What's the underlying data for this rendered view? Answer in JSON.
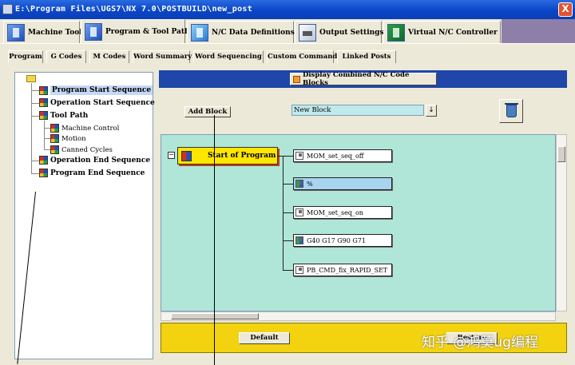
{
  "window": {
    "title": "E:\\Program Files\\UGS7\\NX 7.0\\POSTBUILD\\new_post",
    "close_glyph": "X"
  },
  "main_tabs": [
    {
      "label": "Machine Tool",
      "icon": "machine-tool-icon"
    },
    {
      "label": "Program & Tool Path",
      "icon": "program-toolpath-icon"
    },
    {
      "label": "N/C Data Definitions",
      "icon": "nc-data-icon"
    },
    {
      "label": "Output Settings",
      "icon": "printer-icon"
    },
    {
      "label": "Virtual N/C Controller",
      "icon": "virtual-controller-icon"
    }
  ],
  "sub_tabs": [
    "Program",
    "G Codes",
    "M Codes",
    "Word Summary",
    "Word Sequencing",
    "Custom Command",
    "Linked Posts"
  ],
  "tree": {
    "items": [
      {
        "label": "Program Start Sequence",
        "selected": true
      },
      {
        "label": "Operation Start Sequence"
      },
      {
        "label": "Tool Path"
      },
      {
        "label": "Machine Control"
      },
      {
        "label": "Motion"
      },
      {
        "label": "Canned Cycles"
      },
      {
        "label": "Operation End Sequence"
      },
      {
        "label": "Program End Sequence"
      }
    ]
  },
  "toolbar": {
    "display_combined": "Display Combined N/C Code Blocks",
    "add_block": "Add Block",
    "new_block_value": "New Block",
    "combo_arrow": "↓"
  },
  "diagram": {
    "collapse_glyph": "−",
    "event": "Start of Program",
    "blocks": [
      {
        "label": "MOM_set_seq_off",
        "highlight": false
      },
      {
        "label": "%",
        "highlight": true
      },
      {
        "label": "MOM_set_seq_on",
        "highlight": false
      },
      {
        "label": "G40 G17 G90 G71",
        "highlight": false
      },
      {
        "label": "PB_CMD_fix_RAPID_SET",
        "highlight": false
      }
    ]
  },
  "bottom": {
    "default": "Default",
    "restore": "Restore"
  },
  "watermark": "知乎 @鸿莫ug编程",
  "colors": {
    "title_bar": "#0a46c8",
    "canvas_bg": "#b0e6d8",
    "bottom_bar": "#f3d20f",
    "event_box": "#ffe600"
  }
}
